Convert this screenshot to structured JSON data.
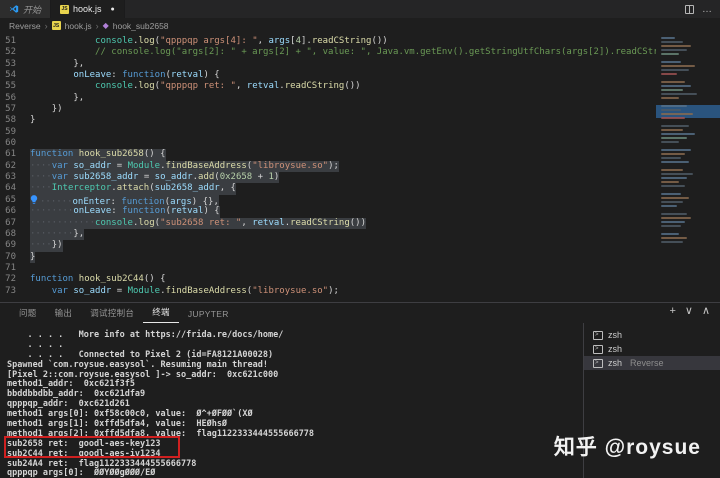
{
  "tabs": [
    {
      "label": "开始",
      "active": false,
      "modified": false
    },
    {
      "label": "hook.js",
      "active": true,
      "modified": true
    }
  ],
  "breadcrumb": {
    "root": "Reverse",
    "file": "hook.js",
    "symbol": "hook_sub2658"
  },
  "icons": {
    "js_badge": "JS",
    "modified_dot": "●",
    "breadcrumb_sep": "›",
    "method_glyph": "◆",
    "plus": "+",
    "chevron_down": "∨",
    "chevron_up": "∧",
    "more": "…",
    "terminal_prompt": ">"
  },
  "editor": {
    "lines": [
      {
        "n": "51",
        "sel": false,
        "t": [
          [
            "ws",
            "            "
          ],
          [
            "cls",
            "console"
          ],
          [
            "pn",
            "."
          ],
          [
            "fn",
            "log"
          ],
          [
            "pn",
            "("
          ],
          [
            "str",
            "\"qpppqp args[4]: \""
          ],
          [
            "pn",
            ", "
          ],
          [
            "var",
            "args"
          ],
          [
            "pn",
            "["
          ],
          [
            "num",
            "4"
          ],
          [
            "pn",
            "]"
          ],
          [
            "pn",
            "."
          ],
          [
            "fn",
            "readCString"
          ],
          [
            "pn",
            "())"
          ]
        ]
      },
      {
        "n": "52",
        "sel": false,
        "t": [
          [
            "ws",
            "            "
          ],
          [
            "cm",
            "// console.log(\"args[2]: \" + args[2] + \", value: \", Java.vm.getEnv().getStringUtfChars(args[2]).readCStri"
          ]
        ]
      },
      {
        "n": "53",
        "sel": false,
        "t": [
          [
            "ws",
            "        "
          ],
          [
            "pn",
            "},"
          ]
        ]
      },
      {
        "n": "54",
        "sel": false,
        "t": [
          [
            "ws",
            "        "
          ],
          [
            "var",
            "onLeave"
          ],
          [
            "pn",
            ": "
          ],
          [
            "kw",
            "function"
          ],
          [
            "pn",
            "("
          ],
          [
            "var",
            "retval"
          ],
          [
            "pn",
            ") {"
          ]
        ]
      },
      {
        "n": "55",
        "sel": false,
        "t": [
          [
            "ws",
            "            "
          ],
          [
            "cls",
            "console"
          ],
          [
            "pn",
            "."
          ],
          [
            "fn",
            "log"
          ],
          [
            "pn",
            "("
          ],
          [
            "str",
            "\"qpppqp ret: \""
          ],
          [
            "pn",
            ", "
          ],
          [
            "var",
            "retval"
          ],
          [
            "pn",
            "."
          ],
          [
            "fn",
            "readCString"
          ],
          [
            "pn",
            "())"
          ]
        ]
      },
      {
        "n": "56",
        "sel": false,
        "t": [
          [
            "ws",
            "        "
          ],
          [
            "pn",
            "},"
          ]
        ]
      },
      {
        "n": "57",
        "sel": false,
        "t": [
          [
            "ws",
            "    "
          ],
          [
            "pn",
            "})"
          ]
        ]
      },
      {
        "n": "58",
        "sel": false,
        "t": [
          [
            "pn",
            "}"
          ]
        ]
      },
      {
        "n": "59",
        "sel": false,
        "t": []
      },
      {
        "n": "60",
        "sel": false,
        "t": []
      },
      {
        "n": "61",
        "sel": true,
        "t": [
          [
            "kw",
            "function"
          ],
          [
            "pn",
            " "
          ],
          [
            "fn",
            "hook_sub2658"
          ],
          [
            "pn",
            "() {"
          ]
        ]
      },
      {
        "n": "62",
        "sel": true,
        "t": [
          [
            "dots",
            "····"
          ],
          [
            "kw",
            "var"
          ],
          [
            "pn",
            " "
          ],
          [
            "var",
            "so_addr"
          ],
          [
            "pn",
            " = "
          ],
          [
            "cls",
            "Module"
          ],
          [
            "pn",
            "."
          ],
          [
            "fn",
            "findBaseAddress"
          ],
          [
            "pn",
            "("
          ],
          [
            "str",
            "\"libroysue.so\""
          ],
          [
            "pn",
            ");"
          ]
        ]
      },
      {
        "n": "63",
        "sel": true,
        "t": [
          [
            "dots",
            "····"
          ],
          [
            "kw",
            "var"
          ],
          [
            "pn",
            " "
          ],
          [
            "var",
            "sub2658_addr"
          ],
          [
            "pn",
            " = "
          ],
          [
            "var",
            "so_addr"
          ],
          [
            "pn",
            "."
          ],
          [
            "fn",
            "add"
          ],
          [
            "pn",
            "("
          ],
          [
            "num",
            "0x2658"
          ],
          [
            "pn",
            " + "
          ],
          [
            "num",
            "1"
          ],
          [
            "pn",
            ")"
          ]
        ]
      },
      {
        "n": "64",
        "sel": true,
        "t": [
          [
            "dots",
            "····"
          ],
          [
            "cls",
            "Interceptor"
          ],
          [
            "pn",
            "."
          ],
          [
            "fn",
            "attach"
          ],
          [
            "pn",
            "("
          ],
          [
            "var",
            "sub2658_addr"
          ],
          [
            "pn",
            ", {"
          ]
        ]
      },
      {
        "n": "65",
        "sel": true,
        "bulb": true,
        "t": [
          [
            "dots",
            "······"
          ],
          [
            "var",
            "onEnter"
          ],
          [
            "pn",
            ": "
          ],
          [
            "kw",
            "function"
          ],
          [
            "pn",
            "("
          ],
          [
            "var",
            "args"
          ],
          [
            "pn",
            ") {},"
          ]
        ]
      },
      {
        "n": "66",
        "sel": true,
        "t": [
          [
            "dots",
            "········"
          ],
          [
            "var",
            "onLeave"
          ],
          [
            "pn",
            ": "
          ],
          [
            "kw",
            "function"
          ],
          [
            "pn",
            "("
          ],
          [
            "var",
            "retval"
          ],
          [
            "pn",
            ") {"
          ]
        ]
      },
      {
        "n": "67",
        "sel": true,
        "t": [
          [
            "dots",
            "············"
          ],
          [
            "cls",
            "console"
          ],
          [
            "pn",
            "."
          ],
          [
            "fn",
            "log"
          ],
          [
            "pn",
            "("
          ],
          [
            "str",
            "\"sub2658 ret: \""
          ],
          [
            "pn",
            ", "
          ],
          [
            "var",
            "retval"
          ],
          [
            "pn",
            "."
          ],
          [
            "fn",
            "readCString"
          ],
          [
            "pn",
            "())"
          ]
        ]
      },
      {
        "n": "68",
        "sel": true,
        "t": [
          [
            "dots",
            "········"
          ],
          [
            "pn",
            "},"
          ]
        ]
      },
      {
        "n": "69",
        "sel": true,
        "t": [
          [
            "dots",
            "····"
          ],
          [
            "pn",
            "})"
          ]
        ]
      },
      {
        "n": "70",
        "sel": true,
        "t": [
          [
            "pn",
            "}"
          ]
        ]
      },
      {
        "n": "71",
        "sel": false,
        "t": []
      },
      {
        "n": "72",
        "sel": false,
        "t": [
          [
            "kw",
            "function"
          ],
          [
            "pn",
            " "
          ],
          [
            "fn",
            "hook_sub2C44"
          ],
          [
            "pn",
            "() {"
          ]
        ]
      },
      {
        "n": "73",
        "sel": false,
        "t": [
          [
            "ws",
            "    "
          ],
          [
            "kw",
            "var"
          ],
          [
            "pn",
            " "
          ],
          [
            "var",
            "so_addr"
          ],
          [
            "pn",
            " = "
          ],
          [
            "cls",
            "Module"
          ],
          [
            "pn",
            "."
          ],
          [
            "fn",
            "findBaseAddress"
          ],
          [
            "pn",
            "("
          ],
          [
            "str",
            "\"libroysue.so\""
          ],
          [
            "pn",
            ");"
          ]
        ]
      }
    ]
  },
  "panel": {
    "tabs": [
      {
        "label": "问题",
        "active": false
      },
      {
        "label": "输出",
        "active": false
      },
      {
        "label": "调试控制台",
        "active": false
      },
      {
        "label": "终端",
        "active": true
      },
      {
        "label": "JUPYTER",
        "active": false
      }
    ]
  },
  "terminal": {
    "lines": [
      "    . . . .   More info at https://frida.re/docs/home/",
      "    . . . .",
      "    . . . .   Connected to Pixel 2 (id=FA8121A00028)",
      "Spawned `com.roysue.easysol`. Resuming main thread!",
      "[Pixel 2::com.roysue.easysol ]-> so_addr:  0xc621c000",
      "method1_addr:  0xc621f3f5",
      "bbddbbdbb_addr:  0xc621dfa9",
      "qpppqp_addr:  0xc621d261",
      "method1 args[0]: 0xf58c00c0, value:  Ø^+ØFØØ`(XØ",
      "method1 args[1]: 0xffd5dfa4, value:  HEØhsØ",
      "method1 args[2]: 0xffd5dfa8, value:  flag1122333444555666778",
      "sub2658 ret:  goodl-aes-key123",
      "sub2C44 ret:  goodl-aes-iv1234",
      "sub24A4 ret:  flag1122333444555666778",
      "qpppqp args[0]:  ØØYØØgØØØ/EØ"
    ],
    "highlight": {
      "lines": [
        "sub2658 ret:  goodl-aes-key123",
        "sub2C44 ret:  goodl-aes-iv1234"
      ],
      "border_color": "#cf2020"
    }
  },
  "terminal_sidebar": {
    "items": [
      {
        "label": "zsh",
        "desc": "",
        "selected": false
      },
      {
        "label": "zsh",
        "desc": "",
        "selected": false
      },
      {
        "label": "zsh",
        "desc": "Reverse",
        "selected": true
      }
    ]
  },
  "watermark": "知乎 @roysue",
  "colors": {
    "editor_bg": "#1e1e1e",
    "tabbar_bg": "#252526",
    "inactive_tab_bg": "#2d2d2d",
    "selection_bg": "#3a3d41",
    "selected_row_bg": "#37373d",
    "keyword": "#569cd6",
    "function": "#dcdcaa",
    "string": "#ce9178",
    "comment": "#6a9955",
    "number": "#b5cea8",
    "variable": "#9cdcfe",
    "class": "#4ec9b0",
    "line_number": "#858585",
    "annotation_red": "#cf2020"
  }
}
